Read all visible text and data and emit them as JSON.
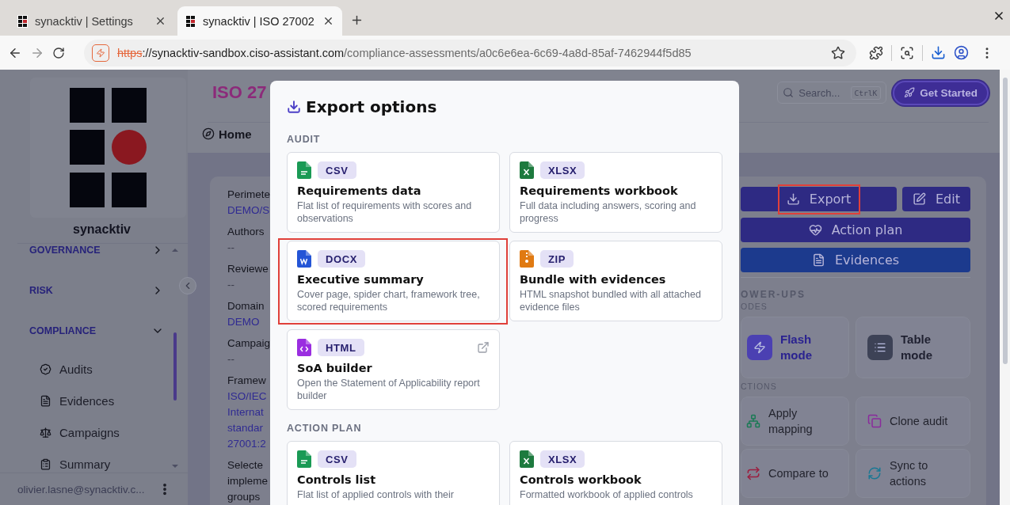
{
  "browser": {
    "tabs": [
      {
        "title": "synacktiv | Settings",
        "selected": false
      },
      {
        "title": "synacktiv | ISO 27002",
        "selected": true
      }
    ],
    "url": {
      "scheme": "https",
      "host": "://synacktiv-sandbox.ciso-assistant.com",
      "path": "/compliance-assessments/a0c6e6ea-6c69-4a8d-85af-7462944f5d85"
    }
  },
  "sidebar": {
    "brand": "synacktiv",
    "items": [
      {
        "label": "GOVERNANCE",
        "expanded": false
      },
      {
        "label": "RISK",
        "expanded": false
      },
      {
        "label": "COMPLIANCE",
        "expanded": true,
        "children": [
          {
            "label": "Audits"
          },
          {
            "label": "Evidences"
          },
          {
            "label": "Campaigns"
          },
          {
            "label": "Summary"
          }
        ]
      }
    ],
    "user": "olivier.lasne@synacktiv.c..."
  },
  "header": {
    "title": "ISO 27",
    "breadcrumb": "Home",
    "search": {
      "placeholder": "Search...",
      "shortcut": "CtrlK"
    },
    "get_started": "Get Started"
  },
  "details": [
    {
      "label": [
        "Perimete"
      ],
      "value": [
        "DEMO/S"
      ],
      "link": true
    },
    {
      "label": [
        "Authors"
      ],
      "value": [
        "--"
      ],
      "link": false
    },
    {
      "label": [
        "Reviewe"
      ],
      "value": [
        "--"
      ],
      "link": false
    },
    {
      "label": [
        "Domain"
      ],
      "value": [
        "DEMO"
      ],
      "link": true
    },
    {
      "label": [
        "Campaig"
      ],
      "value": [
        "--"
      ],
      "link": false
    },
    {
      "label": [
        "Framew"
      ],
      "value": [
        "ISO/IEC",
        "Internat",
        "standar",
        "27001:2"
      ],
      "link": true
    },
    {
      "label": [
        "Selecte",
        "impleme",
        "groups"
      ]
    }
  ],
  "actions": {
    "export": {
      "label": "Export",
      "highlighted": true
    },
    "edit": "Edit",
    "action_plan": "Action plan",
    "evidences": "Evidences"
  },
  "powerups": {
    "title": "OWER-UPS",
    "modes_label": "ODES",
    "modes": [
      {
        "label": "Flash mode",
        "kind": "flash"
      },
      {
        "label": "Table mode",
        "kind": "table"
      }
    ],
    "actions_label": "CTIONS",
    "actions": [
      {
        "label": "Apply mapping",
        "kind": "mapping"
      },
      {
        "label": "Clone audit",
        "kind": "clone"
      },
      {
        "label": "Compare to",
        "kind": "compare"
      },
      {
        "label": "Sync to actions",
        "kind": "sync"
      }
    ]
  },
  "modal": {
    "title": "Export options",
    "sections": [
      {
        "title": "AUDIT",
        "options": [
          {
            "format": "CSV",
            "kind": "csv",
            "title": "Requirements data",
            "description": "Flat list of requirements with scores and observations",
            "highlighted": false,
            "external": false
          },
          {
            "format": "XLSX",
            "kind": "xlsx",
            "title": "Requirements workbook",
            "description": "Full data including answers, scoring and progress",
            "highlighted": false,
            "external": false
          },
          {
            "format": "DOCX",
            "kind": "docx",
            "title": "Executive summary",
            "description": "Cover page, spider chart, framework tree, scored requirements",
            "highlighted": true,
            "external": false
          },
          {
            "format": "ZIP",
            "kind": "zip",
            "title": "Bundle with evidences",
            "description": "HTML snapshot bundled with all attached evidence files",
            "highlighted": false,
            "external": false
          },
          {
            "format": "HTML",
            "kind": "html",
            "title": "SoA builder",
            "description": "Open the Statement of Applicability report builder",
            "highlighted": false,
            "external": true
          }
        ]
      },
      {
        "title": "ACTION PLAN",
        "options": [
          {
            "format": "CSV",
            "kind": "csv",
            "title": "Controls list",
            "description": "Flat list of applied controls with their",
            "highlighted": false,
            "external": false
          },
          {
            "format": "XLSX",
            "kind": "xlsx",
            "title": "Controls workbook",
            "description": "Formatted workbook of applied controls",
            "highlighted": false,
            "external": false
          }
        ]
      }
    ]
  }
}
